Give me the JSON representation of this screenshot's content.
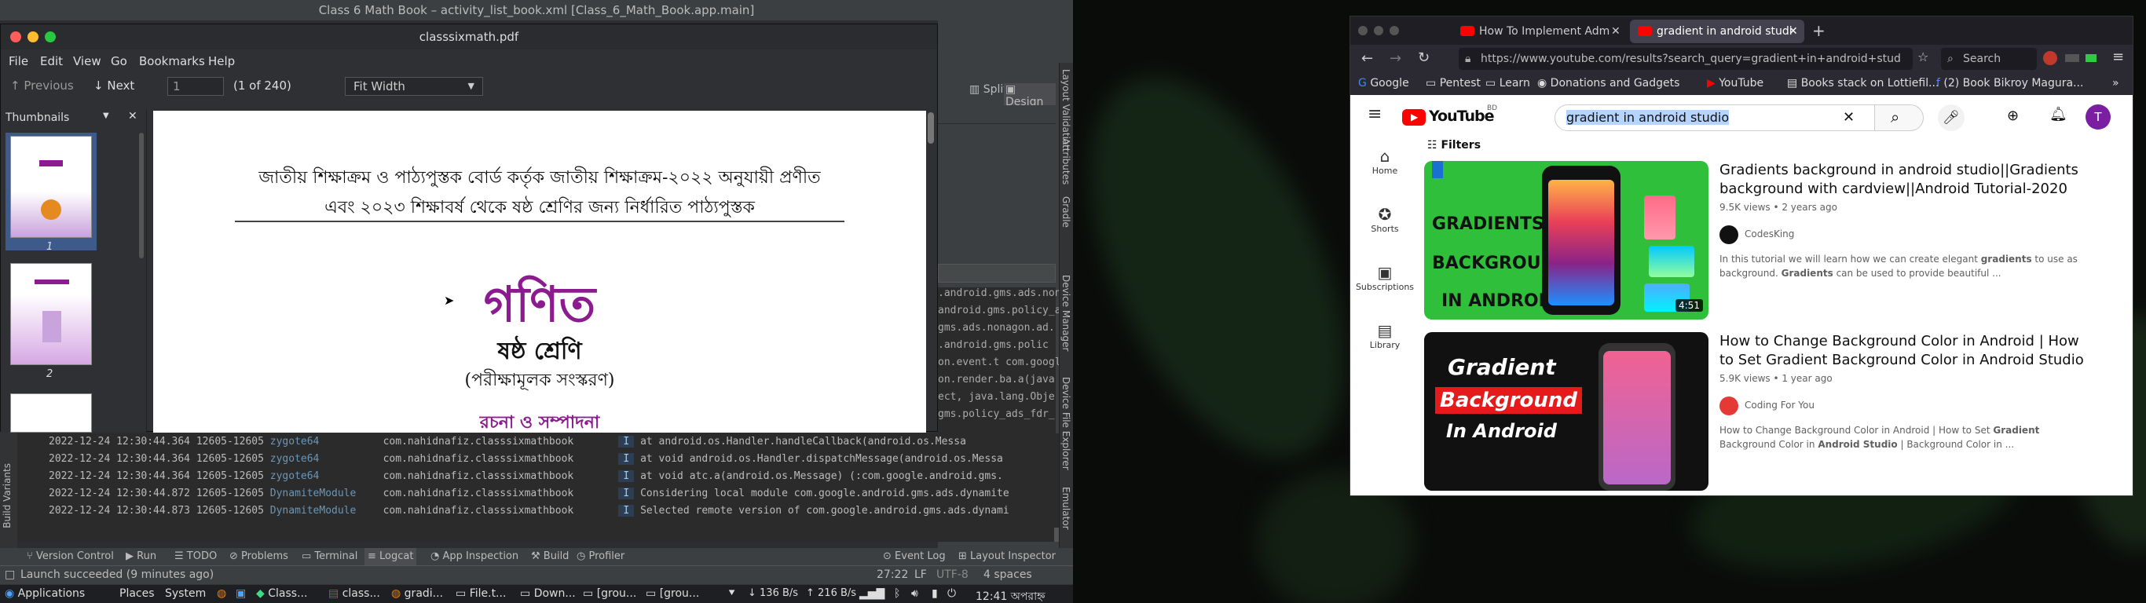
{
  "ide": {
    "title": "Class 6 Math Book – activity_list_book.xml [Class_6_Math_Book.app.main]",
    "split_label": "Split",
    "design_label": "Design",
    "right_panel": {
      "layout_validation": "Layout Validation",
      "attributes": "Attributes",
      "gradle": "Gradle",
      "device_manager": "Device Manager",
      "device_file_explorer": "Device File Explorer",
      "emulator": "Emulator"
    },
    "build_variants": "Build Variants",
    "side_log_fragments": [
      ".android.gms.ads.nonagon.ad.",
      "android.gms.policy_a",
      "gms.ads.nonagon.ad.",
      ".android.gms.polic",
      "on.event.t com.googl",
      "on.render.ba.a(java",
      "ect, java.lang.Obje",
      "gms.policy_ads_fdr_"
    ],
    "log_rows": [
      {
        "date": "2022-12-24 12:30:44.364",
        "pid": "12605-12605",
        "tag": "zygote64",
        "pkg": "com.nahidnafiz.classsixmathbook",
        "lvl": "I",
        "msg": "at android.os.Handler.handleCallback(android.os.Messa"
      },
      {
        "date": "2022-12-24 12:30:44.364",
        "pid": "12605-12605",
        "tag": "zygote64",
        "pkg": "com.nahidnafiz.classsixmathbook",
        "lvl": "I",
        "msg": "at void android.os.Handler.dispatchMessage(android.os.Messa"
      },
      {
        "date": "2022-12-24 12:30:44.364",
        "pid": "12605-12605",
        "tag": "zygote64",
        "pkg": "com.nahidnafiz.classsixmathbook",
        "lvl": "I",
        "msg": "at void atc.a(android.os.Message) (:com.google.android.gms."
      },
      {
        "date": "2022-12-24 12:30:44.872",
        "pid": "12605-12605",
        "tag": "DynamiteModule",
        "pkg": "com.nahidnafiz.classsixmathbook",
        "lvl": "I",
        "msg": "Considering local module com.google.android.gms.ads.dynamite"
      },
      {
        "date": "2022-12-24 12:30:44.873",
        "pid": "12605-12605",
        "tag": "DynamiteModule",
        "pkg": "com.nahidnafiz.classsixmathbook",
        "lvl": "I",
        "msg": "Selected remote version of com.google.android.gms.ads.dynami"
      }
    ],
    "bottom_tabs": [
      "Version Control",
      "Run",
      "TODO",
      "Problems",
      "Terminal",
      "Logcat",
      "App Inspection",
      "Build",
      "Profiler"
    ],
    "event_log": "Event Log",
    "layout_inspector": "Layout Inspector",
    "status_message": "Launch succeeded (9 minutes ago)",
    "cursor_pos": "27:22",
    "line_sep": "LF",
    "encoding": "UTF-8",
    "indent": "4 spaces"
  },
  "pdf": {
    "title": "classsixmath.pdf",
    "menu": [
      "File",
      "Edit",
      "View",
      "Go",
      "Bookmarks",
      "Help"
    ],
    "prev": "Previous",
    "next": "Next",
    "page_value": "1",
    "page_count": "(1 of 240)",
    "zoom": "Fit Width",
    "sidebar_title": "Thumbnails",
    "thumb_labels": [
      "1",
      "2"
    ],
    "page_line1": "জাতীয় শিক্ষাক্রম ও পাঠ্যপুস্তক বোর্ড কর্তৃক জাতীয় শিক্ষাক্রম-২০২২ অনুযায়ী প্রণীত",
    "page_line2": "এবং ২০২৩ শিক্ষাবর্ষ থেকে ষষ্ঠ শ্রেণির জন্য নির্ধারিত পাঠ্যপুস্তক",
    "book_title": "গণিত",
    "grade": "ষষ্ঠ শ্রেণি",
    "edition": "(পরীক্ষামূলক সংস্করণ)",
    "editors": "রচনা ও সম্পাদনা"
  },
  "browser": {
    "tab1": "How To Implement Adm",
    "tab2": "gradient in android studi",
    "url": "https://www.youtube.com/results?search_query=gradient+in+android+stud",
    "search_placeholder": "Search",
    "bookmarks": [
      "Google",
      "Pentest",
      "Learn",
      "Donations and Gadgets",
      "YouTube",
      "Books stack on Lottiefil...",
      "(2) Book Bikroy Magura..."
    ],
    "yt": {
      "logo": "YouTube",
      "country": "BD",
      "query": "gradient in android studio",
      "avatar": "T",
      "filters": "Filters",
      "guide": [
        "Home",
        "Shorts",
        "Subscriptions",
        "Library"
      ],
      "videos": [
        {
          "title": "Gradients background in android studio||Gradients background with cardview||Android Tutorial-2020",
          "meta": "9.5K views • 2 years ago",
          "channel": "CodesKing",
          "desc_a": "In this tutorial we will learn how we can create elegant ",
          "desc_b": "gradients",
          "desc_c": " to use as background. ",
          "desc_d": "Gradients",
          "desc_e": " can be used to provide beautiful ...",
          "duration": "4:51",
          "thumb_line1": "GRADIENTS",
          "thumb_line2": "BACKGROUND",
          "thumb_line3": "IN ANDROID"
        },
        {
          "title": "How to Change Background Color in Android | How to Set Gradient Background Color in Android Studio",
          "meta": "5.9K views • 1 year ago",
          "channel": "Coding For You",
          "desc_a": "How to Change Background Color in Android | How to Set ",
          "desc_b": "Gradient",
          "desc_c": " Background Color in ",
          "desc_d": "Android Studio",
          "desc_e": " | Background Color in ...",
          "thumb_line1": "Gradient",
          "thumb_line2": "Background",
          "thumb_line3": "In Android"
        }
      ]
    }
  },
  "taskbar": {
    "applications": "Applications",
    "places": "Places",
    "system": "System",
    "items": [
      "Class...",
      "class...",
      "gradi...",
      "File.t...",
      "Down...",
      "[grou...",
      "[grou..."
    ],
    "net_down": "136 B/s",
    "net_up": "216 B/s",
    "clock": "12:41 অপরাহ্ন"
  },
  "colors": {
    "ide_bg": "#2b2d30",
    "pdf_purple": "#8b1b8e",
    "yt_red": "#ff0000",
    "gradient_green": "#2fbf3a"
  }
}
